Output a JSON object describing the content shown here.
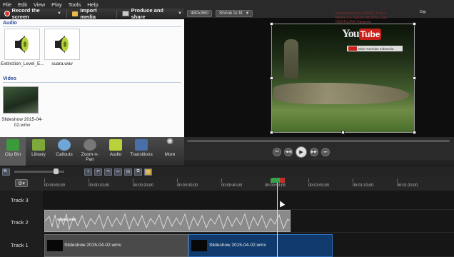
{
  "menu": [
    "File",
    "Edit",
    "View",
    "Play",
    "Tools",
    "Help"
  ],
  "toolbar": {
    "record": "Record the screen",
    "import": "Import media",
    "produce": "Produce and share"
  },
  "clip_bin": {
    "audio_section": "Audio",
    "audio_items": [
      "Extinction_Level_E...",
      "suara.wav"
    ],
    "video_section": "Video",
    "video_items": [
      "Slideshow 2015-04-02.wmv"
    ]
  },
  "tabs": [
    {
      "label": "Clip Bin",
      "icon": "film-icon"
    },
    {
      "label": "Library",
      "icon": "library-icon"
    },
    {
      "label": "Callouts",
      "icon": "callout-icon"
    },
    {
      "label": "Zoom-n-Pan",
      "icon": "zoom-icon"
    },
    {
      "label": "Audio",
      "icon": "speaker-icon"
    },
    {
      "label": "Transitions",
      "icon": "transitions-icon"
    },
    {
      "label": "More",
      "icon": "more-icon"
    }
  ],
  "preview": {
    "dimensions": "480x360",
    "fit": "Shrink to fit",
    "watermark": {
      "text": "Menghasilkan UANG Terus Menerus Tanpa MODAL dan KEAHLIAN Apapun",
      "brand_you": "You",
      "brand_tube": "Tube",
      "subscribe": "Mine YouTube Indonesia",
      "digi": "Digi"
    }
  },
  "timeline": {
    "ruler": [
      "00:00:00;00",
      "00:00:10;00",
      "00:00:20;00",
      "00:00:30;00",
      "00:00:40;00",
      "00:00:53;05",
      "00:01:00;00",
      "00:01:10;00",
      "00:01:20;00"
    ],
    "tracks": [
      "Track 3",
      "Track 2",
      "Track 1"
    ],
    "audio_clip": "suara.wav",
    "video_clips": [
      "Slideshow 2015-04-02.wmv",
      "Slideshow 2015-04-02.wmv"
    ]
  },
  "colors": {
    "record": "#d9342b",
    "selected_clip": "#0f3a6b",
    "playhead": "#3ba04a"
  }
}
